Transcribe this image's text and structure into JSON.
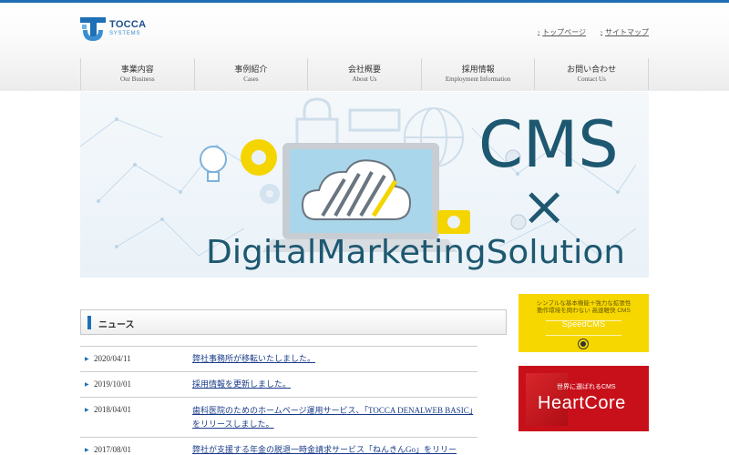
{
  "brand": {
    "name": "TOCCA",
    "sub": "SYSTEMS",
    "primary_color": "#1e6fb5"
  },
  "top_links": [
    {
      "label": "トップページ"
    },
    {
      "label": "サイトマップ"
    }
  ],
  "nav": [
    {
      "ja": "事業内容",
      "en": "Our Business"
    },
    {
      "ja": "事例紹介",
      "en": "Cases"
    },
    {
      "ja": "会社概要",
      "en": "About Us"
    },
    {
      "ja": "採用情報",
      "en": "Employment Information"
    },
    {
      "ja": "お問い合わせ",
      "en": "Contact Us"
    }
  ],
  "hero": {
    "line1": "CMS",
    "line2": "×",
    "line3": "DigitalMarketingSolution"
  },
  "news": {
    "heading": "ニュース",
    "items": [
      {
        "date": "2020/04/11",
        "text": "弊社事務所が移転いたしました。"
      },
      {
        "date": "2019/10/01",
        "text": "採用情報を更新しました。"
      },
      {
        "date": "2018/04/01",
        "text": "歯科医院のためのホームページ運用サービス、「TOCCA DENALWEB BASIC」をリリースしました。"
      },
      {
        "date": "2017/08/01",
        "text": "弊社が支援する年金の脱退一時金請求サービス「ねんきんGo」をリリー"
      }
    ]
  },
  "banners": {
    "speedcms": {
      "tagline1": "シンプルな基本機能＋強力な拡張性",
      "tagline2": "動作環境を問わない 高速軽快 CMS",
      "name": "SpeedCMS",
      "color": "#f6d700"
    },
    "heartcore": {
      "tagline": "世界に選ばれるCMS",
      "name": "HeartCore",
      "color": "#c8101a"
    }
  }
}
